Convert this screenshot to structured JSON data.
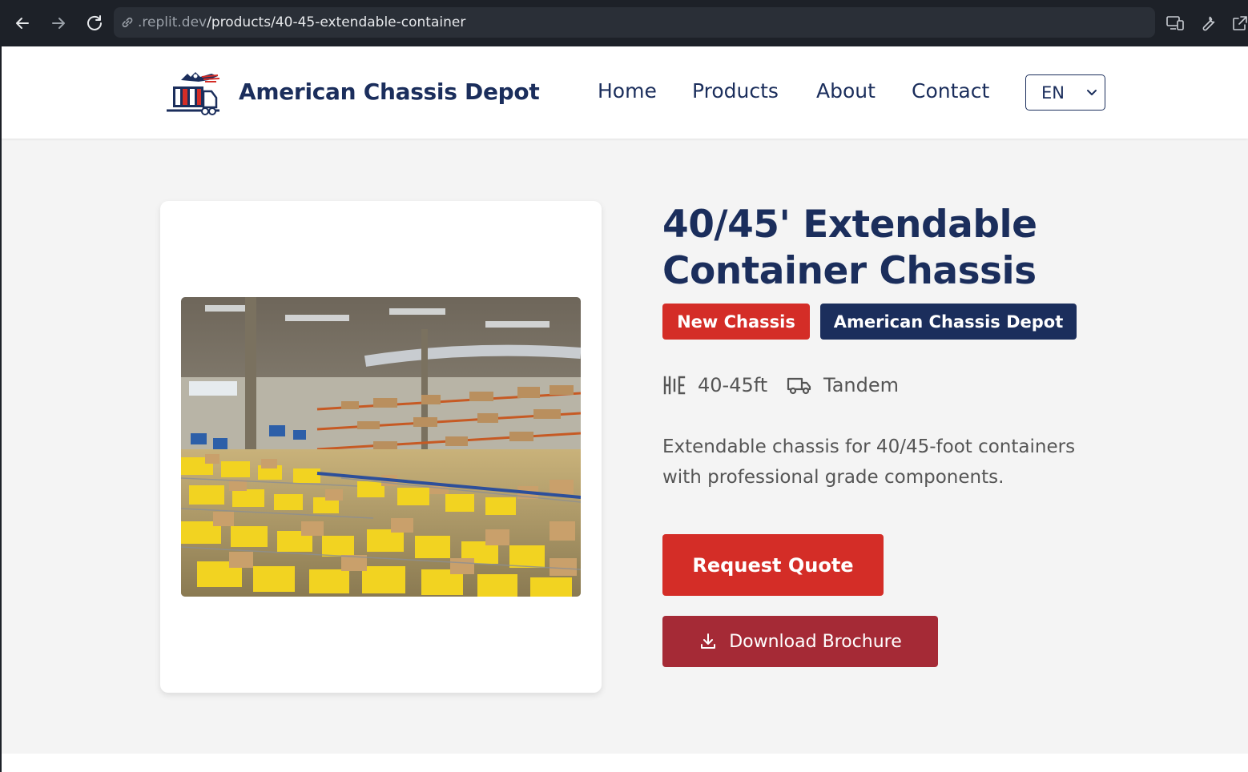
{
  "browser": {
    "url_host": ".replit.dev",
    "url_path": "/products/40-45-extendable-container"
  },
  "header": {
    "brand": "American Chassis Depot",
    "nav": [
      "Home",
      "Products",
      "About",
      "Contact"
    ],
    "language": "EN"
  },
  "product": {
    "title_line1": "40/45' Extendable",
    "title_line2": "Container Chassis",
    "badges": [
      "New Chassis",
      "American Chassis Depot"
    ],
    "specs": {
      "length": "40-45ft",
      "axle": "Tandem"
    },
    "description": "Extendable chassis for 40/45-foot containers with professional grade components.",
    "request_quote": "Request Quote",
    "download_brochure": "Download Brochure",
    "image_subject": "warehouse with yellow bins and cardboard boxes"
  },
  "colors": {
    "brand_navy": "#1b2e5c",
    "accent_red": "#d42d27",
    "brochure_red": "#a52a36",
    "page_bg": "#f4f4f4",
    "chrome_bg": "#1d2128"
  },
  "icons": {
    "back": "arrow-left-icon",
    "forward": "arrow-right-icon",
    "reload": "reload-icon",
    "link": "link-icon",
    "devices": "devices-icon",
    "tools": "wrench-icon",
    "external": "external-link-icon",
    "length": "ruler-icon",
    "axle": "truck-icon",
    "download": "download-icon",
    "chevron": "chevron-down-icon"
  }
}
